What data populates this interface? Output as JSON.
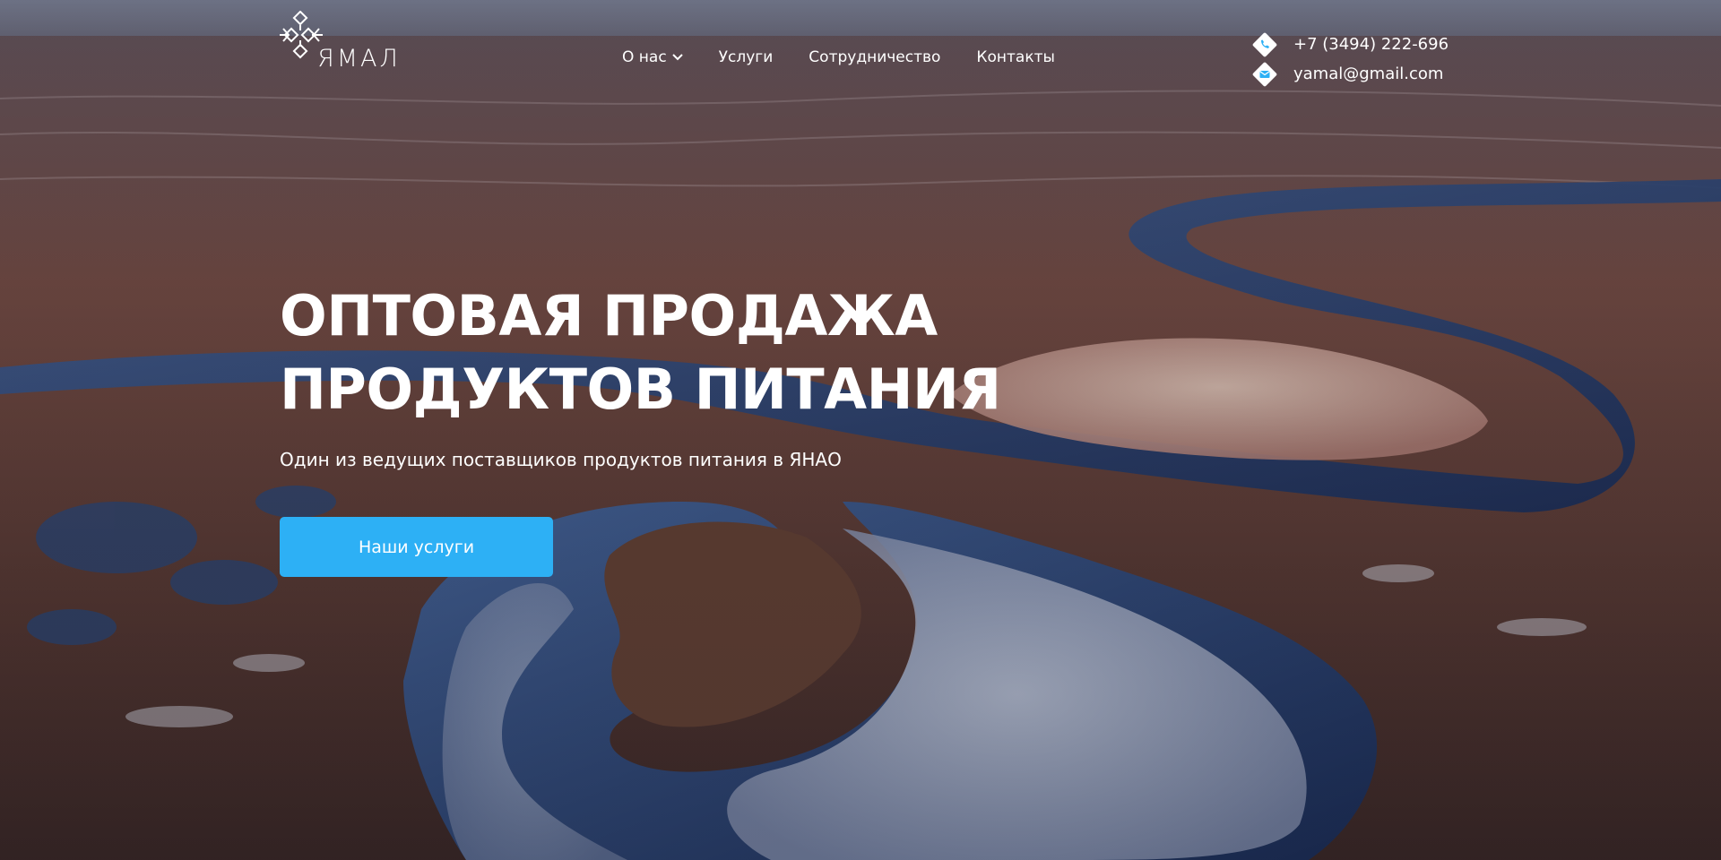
{
  "logo": {
    "text": "ЯМАЛ",
    "icon": "ornament-icon"
  },
  "nav": {
    "items": [
      {
        "label": "О нас",
        "has_dropdown": true
      },
      {
        "label": "Услуги"
      },
      {
        "label": "Сотрудничество"
      },
      {
        "label": "Контакты"
      }
    ]
  },
  "contacts": {
    "phone": "+7 (3494) 222-696",
    "email": "yamal@gmail.com",
    "phone_icon": "phone-icon",
    "email_icon": "mail-icon"
  },
  "hero": {
    "title_line1": "ОПТОВАЯ ПРОДАЖА",
    "title_line2": "ПРОДУКТОВ ПИТАНИЯ",
    "subtitle": "Один из ведущих поставщиков продуктов питания в ЯНАО",
    "cta_label": "Наши услуги"
  },
  "colors": {
    "accent": "#2db0f5",
    "text": "#ffffff"
  }
}
